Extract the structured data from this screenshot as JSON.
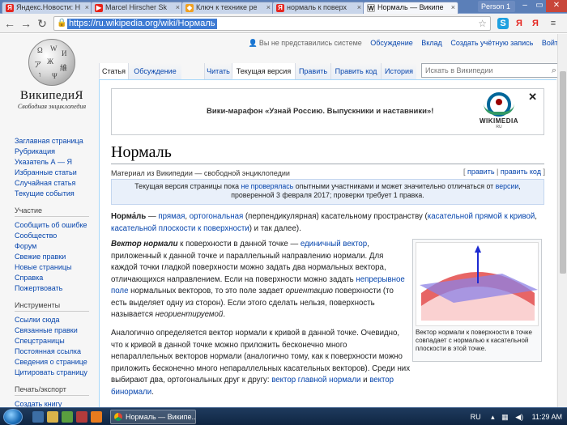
{
  "browser": {
    "tabs": [
      {
        "label": "Яндекс.Новости: Н",
        "fav": "Я",
        "fav_color": "#e52620"
      },
      {
        "label": "Marcel Hirscher Sk",
        "fav": "▶",
        "fav_color": "#e62117"
      },
      {
        "label": "Ключ к технике ре",
        "fav": "◆",
        "fav_color": "#f0a020"
      },
      {
        "label": "нормаль к поверх",
        "fav": "Я",
        "fav_color": "#e52620"
      },
      {
        "label": "Нормаль — Википе",
        "fav": "W",
        "fav_color": "#555555"
      }
    ],
    "profile": "Person 1",
    "url": "https://ru.wikipedia.org/wiki/Нормаль",
    "extensions": [
      "S",
      "Я",
      "Я",
      "≡"
    ]
  },
  "wiki": {
    "wordmark": "ВикипедиЯ",
    "tagline": "Свободная энциклопедия",
    "personal": {
      "anon": "Вы не представились системе",
      "talk": "Обсуждение",
      "contrib": "Вклад",
      "create": "Создать учётную запись",
      "login": "Войти"
    },
    "tabs": {
      "article": "Статья",
      "talk": "Обсуждение",
      "read": "Читать",
      "current": "Текущая версия",
      "edit": "Править",
      "editcode": "Править код",
      "history": "История"
    },
    "search_placeholder": "Искать в Википедии",
    "sidebar": {
      "main": [
        "Заглавная страница",
        "Рубрикация",
        "Указатель А — Я",
        "Избранные статьи",
        "Случайная статья",
        "Текущие события"
      ],
      "participation_heading": "Участие",
      "participation": [
        "Сообщить об ошибке",
        "Сообщество",
        "Форум",
        "Свежие правки",
        "Новые страницы",
        "Справка",
        "Пожертвовать"
      ],
      "tools_heading": "Инструменты",
      "tools": [
        "Ссылки сюда",
        "Связанные правки",
        "Спецстраницы",
        "Постоянная ссылка",
        "Сведения о странице",
        "Цитировать страницу"
      ],
      "print_heading": "Печать/экспорт",
      "print": [
        "Создать книгу"
      ]
    },
    "banner": {
      "text": "Вики-марафон «Узнай Россию. Выпускники и наставники»!",
      "logo_text": "WIKIMEDIA",
      "logo_sub": "RU",
      "close": "✕"
    },
    "title": "Нормаль",
    "from_wiki": "Материал из Википедии — свободной энциклопедии",
    "edit_links": {
      "edit": "править",
      "editcode": "править код"
    },
    "notice": {
      "t1": "Текущая версия страницы пока ",
      "l1": "не проверялась",
      "t2": " опытными участниками и может значительно отличаться от ",
      "l2": "версии",
      "t3": ", проверенной 3 февраля 2017; проверки требует 1 правка."
    },
    "p1": {
      "b": "Норма́ль",
      "t1": " — ",
      "l1": "прямая",
      "t2": ", ",
      "l2": "ортогональная",
      "t3": " (перпендикулярная) касательному пространству (",
      "l3": "касательной прямой к кривой",
      "t4": ", ",
      "l4": "касательной плоскости к поверхности",
      "t5": ") и так далее)."
    },
    "p2": {
      "b": "Вектор нормали",
      "t1": " к поверхности в данной точке — ",
      "l1": "единичный вектор",
      "t2": ", приложенный к данной точке и параллельный направлению нормали. Для каждой точки гладкой поверхности можно задать два нормальных вектора, отличающихся направлением. Если на поверхности можно задать ",
      "l2": "непрерывное поле",
      "t3": " нормальных векторов, то это поле задает ",
      "i1": "ориентацию",
      "t4": " поверхности (то есть выделяет одну из сторон). Если этого сделать нельзя, поверхность называется ",
      "i2": "неориентируемой",
      "t5": "."
    },
    "p3": {
      "t1": "Аналогично определяется вектор нормали к кривой в данной точке. Очевидно, что к кривой в данной точке можно приложить бесконечно много непараллельных векторов нормали (аналогично тому, как к поверхности можно приложить бесконечно много непараллельных касательных векторов). Среди них выбирают два, ортогональных друг к другу: ",
      "l1": "вектор главной нормали",
      "t2": " и ",
      "l2": "вектор бинормали",
      "t3": "."
    },
    "figure_caption": "Вектор нормали к поверхности в точке совпадает с нормалью к касательной плоскости в этой точке."
  },
  "taskbar": {
    "task_label": "Нормаль — Википе...",
    "lang": "RU",
    "time": "11:29 AM"
  }
}
